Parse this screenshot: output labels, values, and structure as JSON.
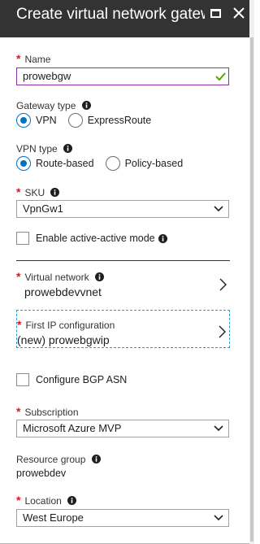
{
  "header": {
    "title": "Create virtual network gatew...",
    "maximize_icon": "maximize-icon",
    "close_icon": "close-icon"
  },
  "name": {
    "label": "Name",
    "value": "prowebgw",
    "required": true,
    "valid": true
  },
  "gateway_type": {
    "label": "Gateway type",
    "options": [
      "VPN",
      "ExpressRoute"
    ],
    "selected": "VPN"
  },
  "vpn_type": {
    "label": "VPN type",
    "options": [
      "Route-based",
      "Policy-based"
    ],
    "selected": "Route-based"
  },
  "sku": {
    "label": "SKU",
    "value": "VpnGw1",
    "required": true
  },
  "active_active": {
    "label": "Enable active-active mode",
    "checked": false
  },
  "virtual_network": {
    "label": "Virtual network",
    "value": "prowebdevvnet",
    "required": true
  },
  "first_ip": {
    "label": "First IP configuration",
    "value": "(new) prowebgwip",
    "required": true
  },
  "bgp": {
    "label": "Configure BGP ASN",
    "checked": false
  },
  "subscription": {
    "label": "Subscription",
    "value": "Microsoft Azure MVP",
    "required": true
  },
  "resource_group": {
    "label": "Resource group",
    "value": "prowebdev"
  },
  "location": {
    "label": "Location",
    "value": "West Europe",
    "required": true
  },
  "colors": {
    "header_bg": "#333333",
    "accent": "#0072c6",
    "required": "#e81123",
    "valid": "#57a300",
    "focus_border": "#1fa0d0"
  }
}
